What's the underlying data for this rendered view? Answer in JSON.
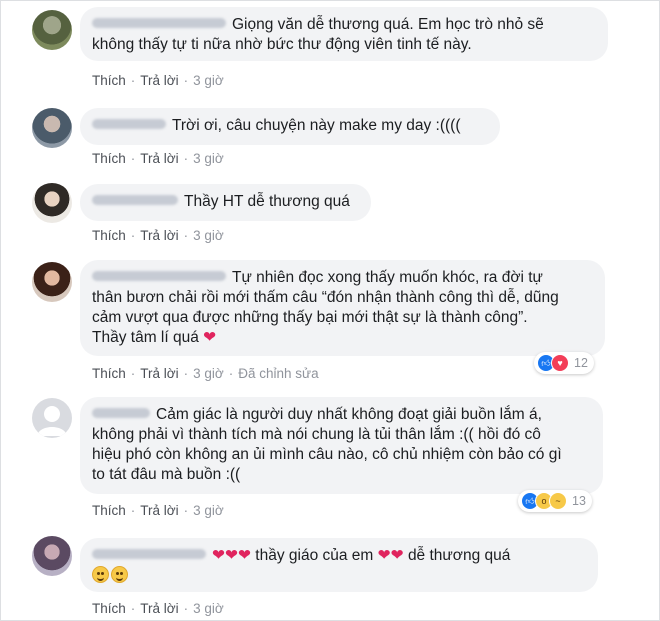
{
  "comments": [
    {
      "id": "c1",
      "author": "Lê Trần Minh Hảo",
      "lines": [
        "Giọng văn dễ thương quá. Em học trò nhỏ sẽ",
        "không thấy tự ti nữa nhờ bức thư động viên tinh tế này."
      ],
      "like_label": "Thích",
      "reply_label": "Trả lời",
      "time": "3 giờ"
    },
    {
      "id": "c2",
      "author": "Kun Yuhsic",
      "lines": [
        "Trời ơi, câu chuyện này make my day :(((("
      ],
      "like_label": "Thích",
      "reply_label": "Trả lời",
      "time": "3 giờ"
    },
    {
      "id": "c3",
      "author": "Lê Phương",
      "lines": [
        "Thầy HT dễ thương quá"
      ],
      "like_label": "Thích",
      "reply_label": "Trả lời",
      "time": "3 giờ"
    },
    {
      "id": "c4",
      "author": "Trần Ngọc Huyền",
      "lines": [
        "Tự nhiên đọc xong thấy muốn khóc, ra đời tự",
        "thân bươn chải rồi mới thấm câu “đón nhận thành công thì dễ, dũng",
        "cảm vượt qua được những thấy bại mới thật sự là thành công”.",
        "Thầy tâm lí quá"
      ],
      "heart": "❤",
      "like_label": "Thích",
      "reply_label": "Trả lời",
      "time": "3 giờ",
      "edited": "Đã chỉnh sửa",
      "reaction_count": "12",
      "reactions": [
        "like-icon",
        "love-icon"
      ]
    },
    {
      "id": "c5",
      "author": "Mai Lan",
      "lines": [
        "Cảm giác là người duy nhất không đoạt giải buồn lắm á,",
        "không phải vì thành tích mà nói chung là tủi thân lắm :(( hồi đó cô",
        "hiệu phó còn không an ủi mình câu nào, cô chủ nhiệm còn bảo có gì",
        "to tát đâu mà buồn :(("
      ],
      "like_label": "Thích",
      "reply_label": "Trả lời",
      "time": "3 giờ",
      "reaction_count": "13",
      "reactions": [
        "like-icon",
        "wow-icon",
        "sad-icon"
      ]
    },
    {
      "id": "c6",
      "author": "Lê Hồng Ngọc",
      "hearts_before": "❤❤❤",
      "text_middle": "thầy giáo của em",
      "hearts_after": "❤❤",
      "text_end": "dễ thương quá",
      "like_label": "Thích",
      "reply_label": "Trả lời",
      "time": "3 giờ"
    }
  ],
  "separator": "·"
}
